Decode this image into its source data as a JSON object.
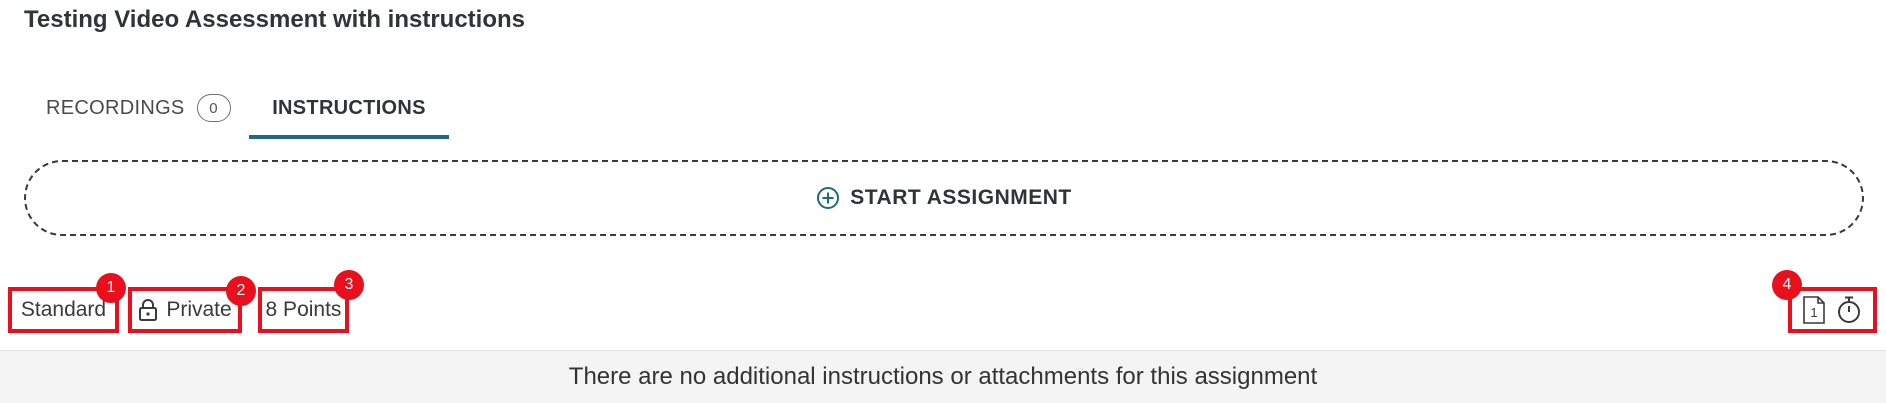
{
  "page": {
    "title": "Testing Video Assessment with instructions"
  },
  "tabs": [
    {
      "label": "RECORDINGS",
      "count": "0",
      "active": false
    },
    {
      "label": "INSTRUCTIONS",
      "active": true
    }
  ],
  "start_assignment": {
    "icon": "plus-circle-icon",
    "label": "START ASSIGNMENT"
  },
  "meta": {
    "type_label": "Standard",
    "visibility_label": "Private",
    "points_label": "8 Points",
    "page_icon_number": "1"
  },
  "annotations": [
    "1",
    "2",
    "3",
    "4"
  ],
  "message": {
    "text": "There are no additional instructions or attachments for this assignment"
  },
  "colors": {
    "accent": "#1c6b82",
    "annotation": "#e8101c"
  }
}
